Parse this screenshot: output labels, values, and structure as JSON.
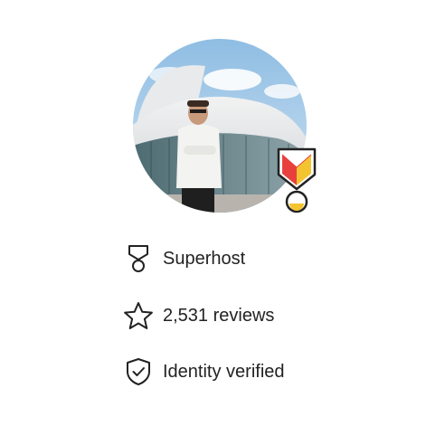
{
  "profile": {
    "photo_alt": "profile-photo",
    "badge_colors": {
      "red": "#e8413d",
      "yellow": "#f4c430",
      "dark": "#222222"
    }
  },
  "stats": [
    {
      "icon": "medal-icon",
      "label": "Superhost"
    },
    {
      "icon": "star-icon",
      "label": "2,531 reviews"
    },
    {
      "icon": "shield-check-icon",
      "label": "Identity verified"
    }
  ]
}
